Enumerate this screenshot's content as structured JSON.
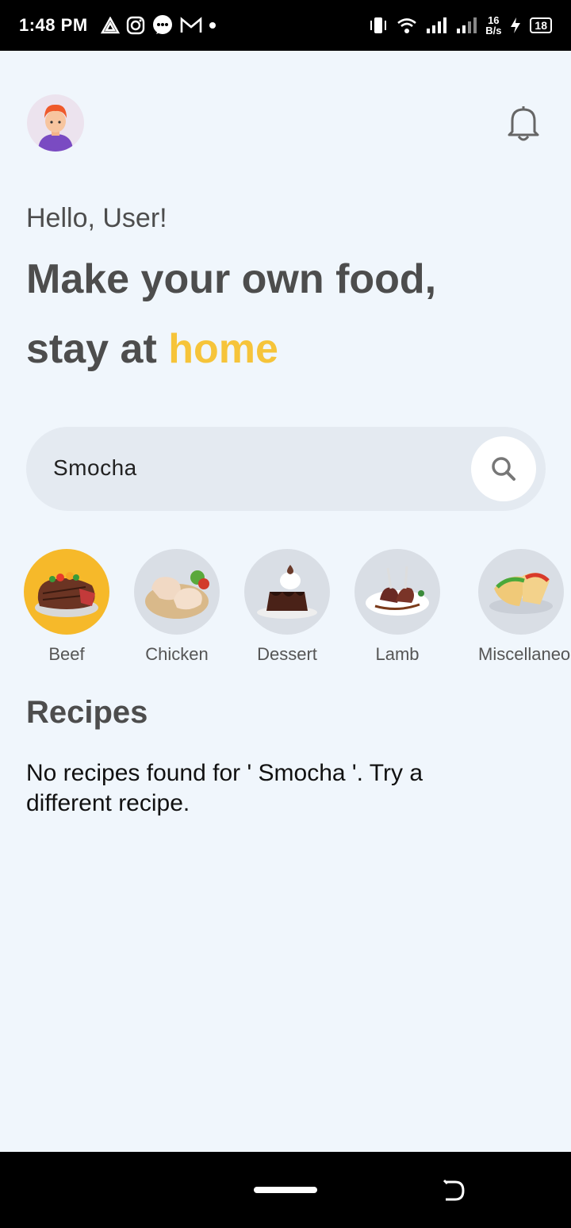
{
  "status_bar": {
    "time": "1:48 PM",
    "net_speed_value": "16",
    "net_speed_unit": "B/s",
    "battery": "18"
  },
  "header": {
    "greeting": "Hello, User!",
    "headline_line1": "Make your own food,",
    "headline_line2_prefix": "stay at ",
    "headline_line2_accent": "home"
  },
  "search": {
    "value": "Smocha"
  },
  "categories": [
    {
      "label": "Beef",
      "active": true
    },
    {
      "label": "Chicken",
      "active": false
    },
    {
      "label": "Dessert",
      "active": false
    },
    {
      "label": "Lamb",
      "active": false
    },
    {
      "label": "Miscellaneous",
      "active": false
    }
  ],
  "recipes": {
    "title": "Recipes",
    "empty_message": "No recipes found for ' Smocha '. Try a different recipe."
  },
  "colors": {
    "background": "#f0f6fc",
    "accent": "#f6c43a",
    "active_category": "#f6b92a"
  }
}
